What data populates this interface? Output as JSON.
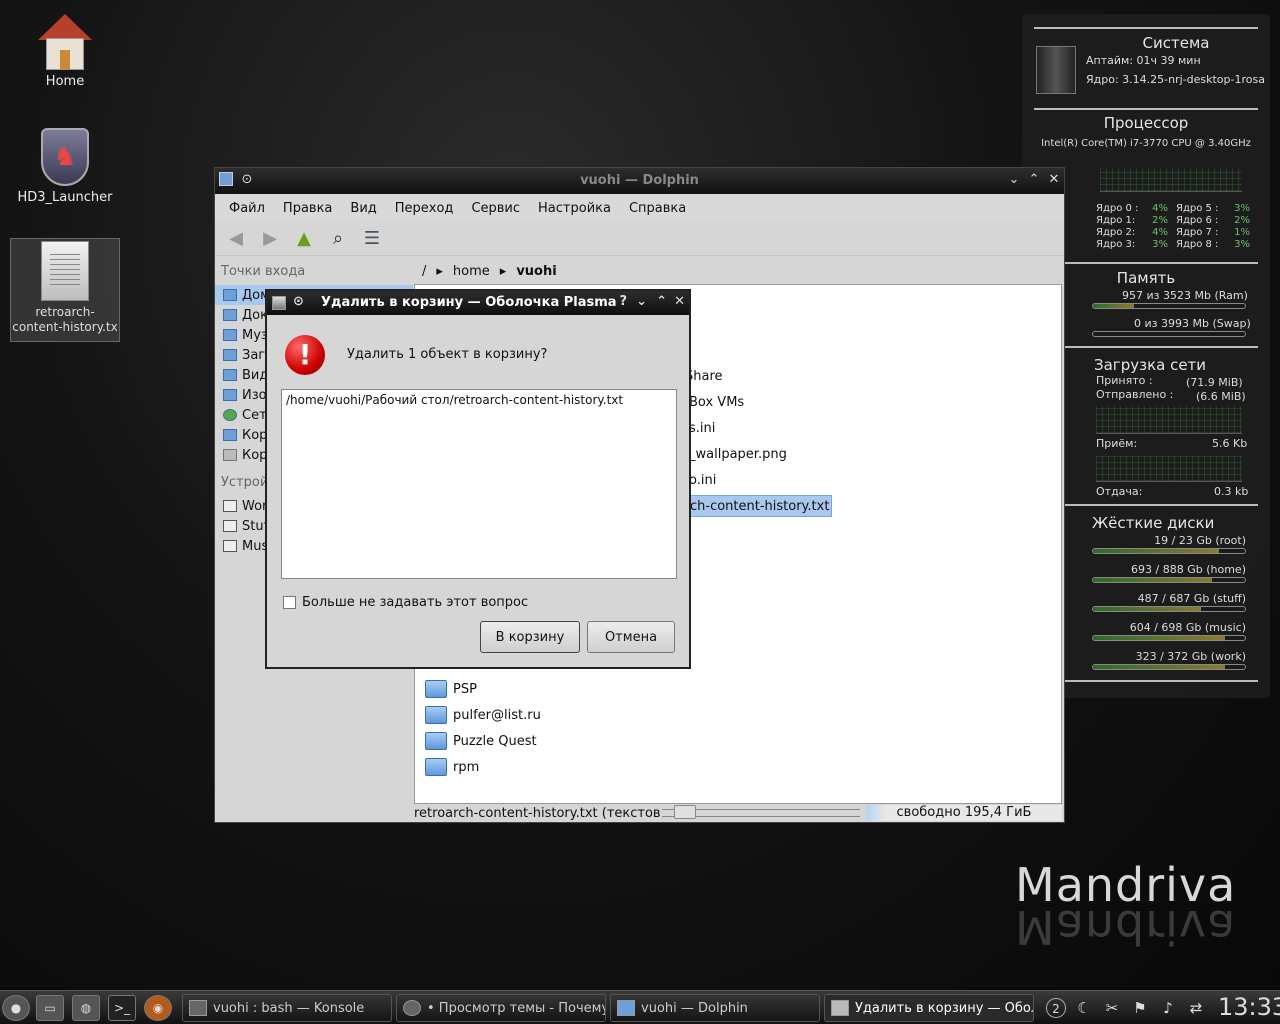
{
  "desktop": {
    "icons": [
      {
        "label": "Home"
      },
      {
        "label": "HD3_Launcher"
      },
      {
        "label": "retroarch-content-history.txt",
        "label_display": "retroarch-\ncontent-history.tx"
      }
    ],
    "brand": "Mandriva"
  },
  "widget": {
    "system": {
      "title": "Система",
      "uptime": "Аптайм: 01ч 39 мин",
      "kernel": "Ядро: 3.14.25-nrj-desktop-1rosa"
    },
    "cpu": {
      "title": "Процессор",
      "model": "Intel(R) Core(TM) i7-3770 CPU @ 3.40GHz",
      "cores_left": [
        {
          "label": "Ядро 0 :",
          "value": "4%"
        },
        {
          "label": "Ядро 1:",
          "value": "2%"
        },
        {
          "label": "Ядро 2:",
          "value": "4%"
        },
        {
          "label": "Ядро 3:",
          "value": "3%"
        }
      ],
      "cores_right": [
        {
          "label": "Ядро 5 :",
          "value": "3%"
        },
        {
          "label": "Ядро 6 :",
          "value": "2%"
        },
        {
          "label": "Ядро 7 :",
          "value": "1%"
        },
        {
          "label": "Ядро 8 :",
          "value": "3%"
        }
      ]
    },
    "memory": {
      "title": "Память",
      "ram": "957  из  3523 Mb  (Ram)",
      "ram_fraction": 0.27,
      "swap": "0  из  3993 Mb (Swap)",
      "swap_fraction": 0.0
    },
    "network": {
      "title": "Загрузка сети",
      "received_label": "Принято :",
      "received": "(71.9 MiB)",
      "sent_label": "Отправлено :",
      "sent": "(6.6 MiB)",
      "rx_label": "Приём:",
      "rx": "5.6 Kb",
      "tx_label": "Отдача:",
      "tx": "0.3 kb"
    },
    "disks": {
      "title": "Жёсткие диски",
      "items": [
        {
          "label": "19 / 23 Gb (root)",
          "fraction": 0.83
        },
        {
          "label": "693 / 888 Gb (home)",
          "fraction": 0.78
        },
        {
          "label": "487 / 687 Gb (stuff)",
          "fraction": 0.71
        },
        {
          "label": "604 / 698 Gb (music)",
          "fraction": 0.87
        },
        {
          "label": "323 / 372 Gb (work)",
          "fraction": 0.87
        }
      ]
    }
  },
  "dolphin": {
    "title": "vuohi — Dolphin",
    "menu": [
      "Файл",
      "Правка",
      "Вид",
      "Переход",
      "Сервис",
      "Настройка",
      "Справка"
    ],
    "places_header": "Точки входа",
    "places": [
      "Дом",
      "Док",
      "Муз",
      "Загр",
      "Вид",
      "Изо",
      "Сет",
      "Кор",
      "Кор"
    ],
    "devices_header": "Устрой",
    "devices": [
      "Wor",
      "Stuf",
      "Mus"
    ],
    "breadcrumb": [
      "/",
      "home",
      "vuohi"
    ],
    "file_fragments": [
      "Share",
      "Box VMs",
      "s.ini",
      "_wallpaper.png",
      "o.ini",
      "ch-content-history.txt"
    ],
    "files": [
      "PSP",
      "pulfer@list.ru",
      "Puzzle Quest",
      "rpm"
    ],
    "status_text": "retroarch-content-history.txt (текстов…",
    "free_space": "свободно 195,4 ГиБ"
  },
  "dialog": {
    "title": "Удалить в корзину — Оболочка Plasma",
    "question": "Удалить 1 объект в корзину?",
    "path": "/home/vuohi/Рабочий стол/retroarch-content-history.txt",
    "checkbox_label": "Больше не задавать этот вопрос",
    "confirm_label": "В корзину",
    "cancel_label": "Отмена"
  },
  "taskbar": {
    "tasks": [
      {
        "label": "vuohi : bash — Konsole"
      },
      {
        "label": "• Просмотр темы - Почему кн"
      },
      {
        "label": "vuohi — Dolphin"
      },
      {
        "label": "Удалить в корзину — Оболоч"
      }
    ],
    "pager": "2",
    "clock": "13:33"
  },
  "colors": {
    "accent": "#a8c8ee",
    "alert": "#cc0000",
    "panel_bg": "#1e1e1e"
  }
}
